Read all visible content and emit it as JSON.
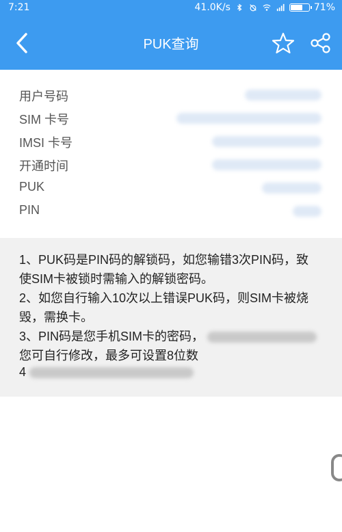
{
  "status_bar": {
    "time": "7:21",
    "network_speed": "41.0K/s",
    "battery_percent": "71%",
    "battery_level": 0.71
  },
  "app_bar": {
    "title": "PUK查询",
    "back_icon": "chevron-left-icon",
    "favorite_icon": "star-icon",
    "share_icon": "share-icon"
  },
  "info": {
    "rows": [
      {
        "label": "用户号码"
      },
      {
        "label": "SIM 卡号"
      },
      {
        "label": "IMSI 卡号"
      },
      {
        "label": "开通时间"
      },
      {
        "label": "PUK"
      },
      {
        "label": "PIN"
      }
    ]
  },
  "notes": {
    "lines": [
      "1、PUK码是PIN码的解锁码，如您输错3次PIN码，致",
      "使SIM卡被锁时需输入的解锁密码。",
      "2、如您自行输入10次以上错误PUK码，则SIM卡被烧",
      "毁，需换卡。",
      "3、PIN码是您手机SIM卡的密码，",
      "您可自行修改，最多可设置8位数",
      "4"
    ]
  },
  "colors": {
    "header": "#3d9bf0",
    "notes_bg": "#f1f1f1"
  }
}
